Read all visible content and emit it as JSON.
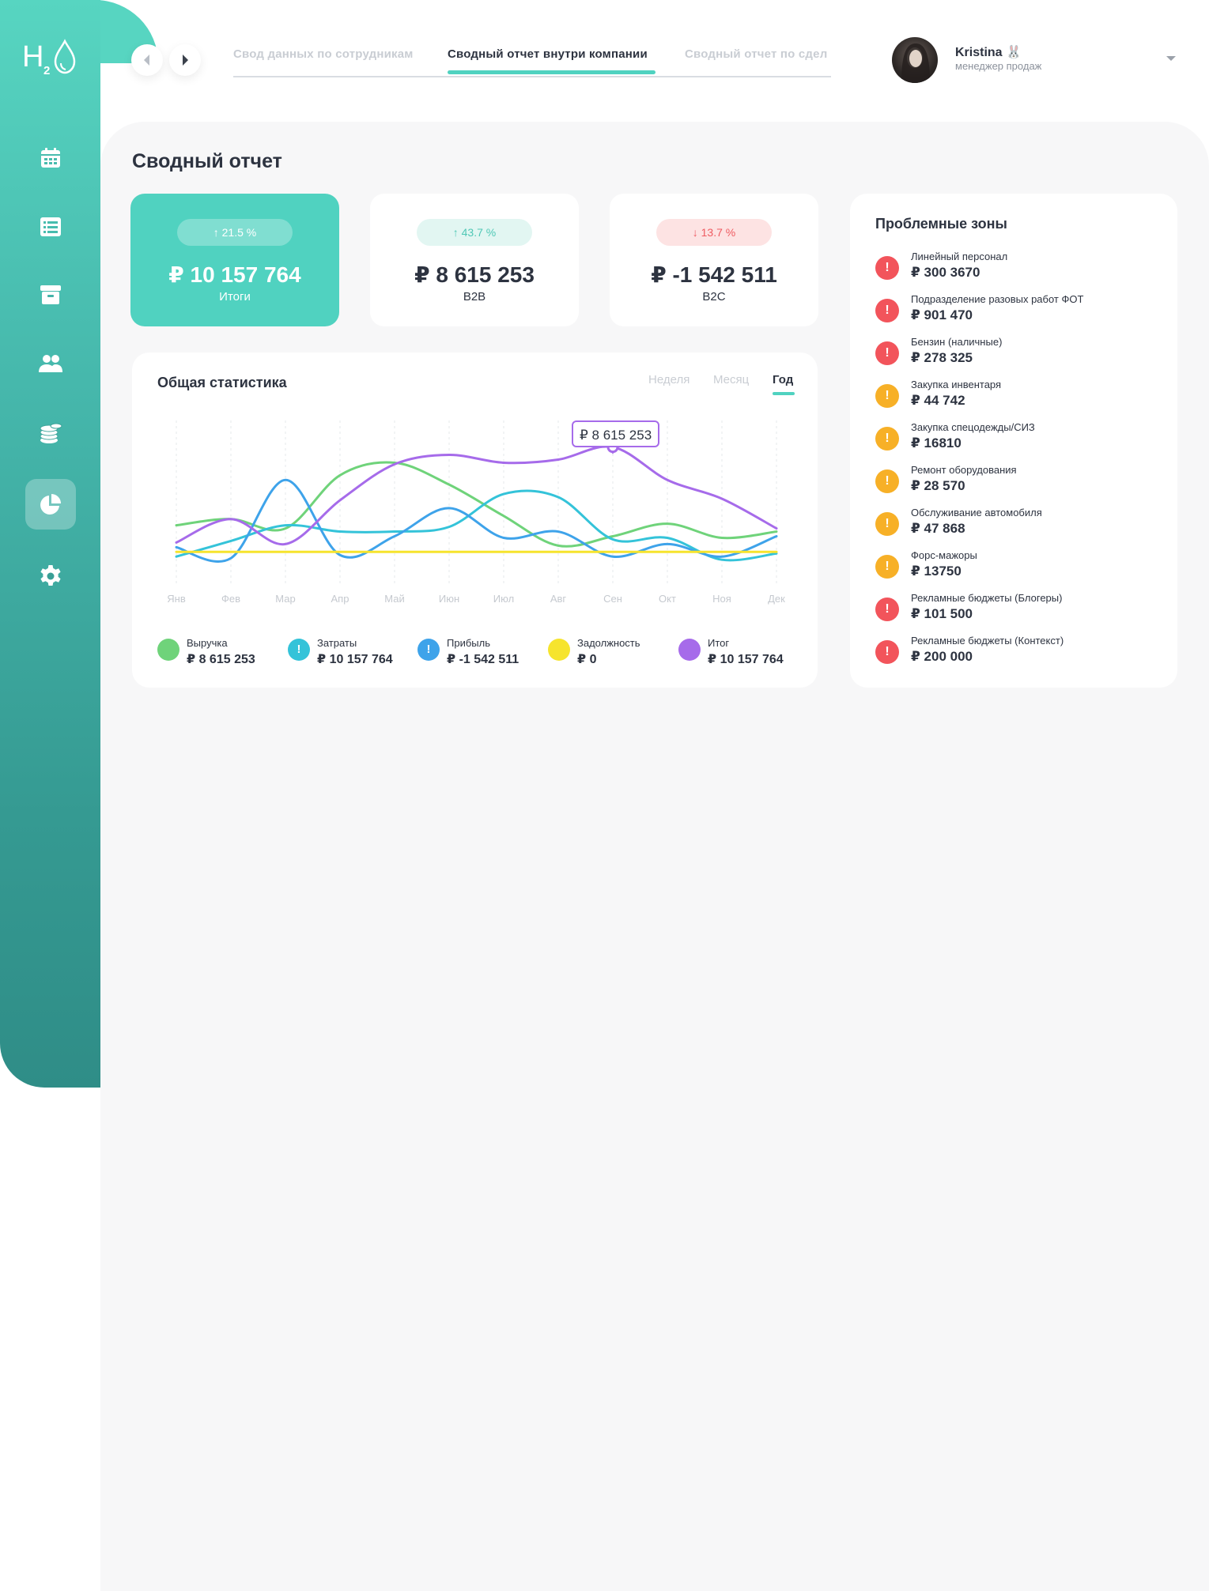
{
  "app": {
    "logo_text": "H2"
  },
  "colors": {
    "accent": "#50d2c0",
    "danger": "#f2545b",
    "warning": "#f7b027",
    "sidebar_top": "#57d5c1",
    "sidebar_bottom": "#2f8d87"
  },
  "sidebar": {
    "items": [
      {
        "icon": "calendar-icon",
        "active": false
      },
      {
        "icon": "list-icon",
        "active": false
      },
      {
        "icon": "archive-icon",
        "active": false
      },
      {
        "icon": "users-icon",
        "active": false
      },
      {
        "icon": "coins-icon",
        "active": false
      },
      {
        "icon": "pie-chart-icon",
        "active": true
      },
      {
        "icon": "gear-icon",
        "active": false
      }
    ]
  },
  "topbar": {
    "tabs": [
      {
        "label": "Свод данных по сотрудникам",
        "active": false
      },
      {
        "label": "Сводный отчет внутри компании",
        "active": true
      },
      {
        "label": "Сводный отчет по сдел",
        "active": false
      }
    ],
    "user": {
      "name": "Kristina 🐰",
      "role": "менеджер продаж"
    }
  },
  "page": {
    "title": "Сводный отчет"
  },
  "kpis": [
    {
      "badge": "↑ 21.5 %",
      "value": "₽  10 157 764",
      "label": "Итоги",
      "trend": "up",
      "primary": true
    },
    {
      "badge": "↑ 43.7 %",
      "value": "₽  8 615 253",
      "label": "B2B",
      "trend": "up",
      "primary": false
    },
    {
      "badge": "↓ 13.7 %",
      "value": "₽  -1 542 511",
      "label": "B2C",
      "trend": "down",
      "primary": false
    }
  ],
  "stats": {
    "title": "Общая статистика",
    "periods": [
      {
        "label": "Неделя",
        "active": false
      },
      {
        "label": "Месяц",
        "active": false
      },
      {
        "label": "Год",
        "active": true
      }
    ],
    "tooltip": "₽ 8 615 253",
    "legend": [
      {
        "name": "Выручка",
        "value": "₽ 8 615 253",
        "color": "#6fd37a",
        "mark": ""
      },
      {
        "name": "Затраты",
        "value": "₽ 10 157 764",
        "color": "#34c3d9",
        "mark": "!"
      },
      {
        "name": "Прибыль",
        "value": "₽ -1 542 511",
        "color": "#3ea3ea",
        "mark": "!"
      },
      {
        "name": "Задолжность",
        "value": "₽ 0",
        "color": "#f6e42d",
        "mark": ""
      },
      {
        "name": "Итог",
        "value": "₽ 10 157 764",
        "color": "#a66bea",
        "mark": ""
      }
    ]
  },
  "chart_data": {
    "type": "line",
    "categories": [
      "Янв",
      "Фев",
      "Мар",
      "Апр",
      "Май",
      "Июн",
      "Июл",
      "Авг",
      "Сен",
      "Окт",
      "Ноя",
      "Дек"
    ],
    "ylim": [
      0,
      100
    ],
    "grid": "vertical dashed",
    "legend_position": "bottom",
    "series": [
      {
        "name": "Выручка",
        "color": "#6fd37a",
        "values": [
          32,
          36,
          30,
          64,
          72,
          58,
          38,
          19,
          25,
          33,
          24,
          28
        ]
      },
      {
        "name": "Затраты",
        "color": "#34c3d9",
        "values": [
          12,
          22,
          32,
          28,
          28,
          31,
          52,
          50,
          23,
          24,
          10,
          14
        ]
      },
      {
        "name": "Прибыль",
        "color": "#3ea3ea",
        "values": [
          18,
          11,
          61,
          13,
          25,
          43,
          24,
          28,
          12,
          20,
          12,
          25
        ]
      },
      {
        "name": "Задолжность",
        "color": "#f6e42d",
        "values": [
          15,
          15,
          15,
          15,
          15,
          15,
          15,
          15,
          15,
          15,
          15,
          15
        ]
      },
      {
        "name": "Итог",
        "color": "#a66bea",
        "values": [
          21,
          36,
          20,
          48,
          71,
          77,
          72,
          74,
          82,
          61,
          49,
          30
        ]
      }
    ],
    "highlight": {
      "series": "Итог",
      "category": "Сен",
      "label": "₽ 8 615 253"
    }
  },
  "problems": {
    "title": "Проблемные зоны",
    "items": [
      {
        "name": "Линейный персонал",
        "value": "₽ 300 3670",
        "severity": "danger"
      },
      {
        "name": "Подразделение разовых работ ФОТ",
        "value": "₽ 901 470",
        "severity": "danger"
      },
      {
        "name": "Бензин (наличные)",
        "value": "₽ 278 325",
        "severity": "danger"
      },
      {
        "name": "Закупка инвентаря",
        "value": "₽ 44 742",
        "severity": "warning"
      },
      {
        "name": "Закупка спецодежды/СИЗ",
        "value": "₽ 16810",
        "severity": "warning"
      },
      {
        "name": "Ремонт оборудования",
        "value": "₽ 28 570",
        "severity": "warning"
      },
      {
        "name": "Обслуживание автомобиля",
        "value": "₽ 47 868",
        "severity": "warning"
      },
      {
        "name": "Форс-мажоры",
        "value": "₽ 13750",
        "severity": "warning"
      },
      {
        "name": "Рекламные бюджеты (Блогеры)",
        "value": "₽ 101 500",
        "severity": "danger"
      },
      {
        "name": "Рекламные бюджеты (Контекст)",
        "value": "₽ 200 000",
        "severity": "danger"
      }
    ]
  }
}
